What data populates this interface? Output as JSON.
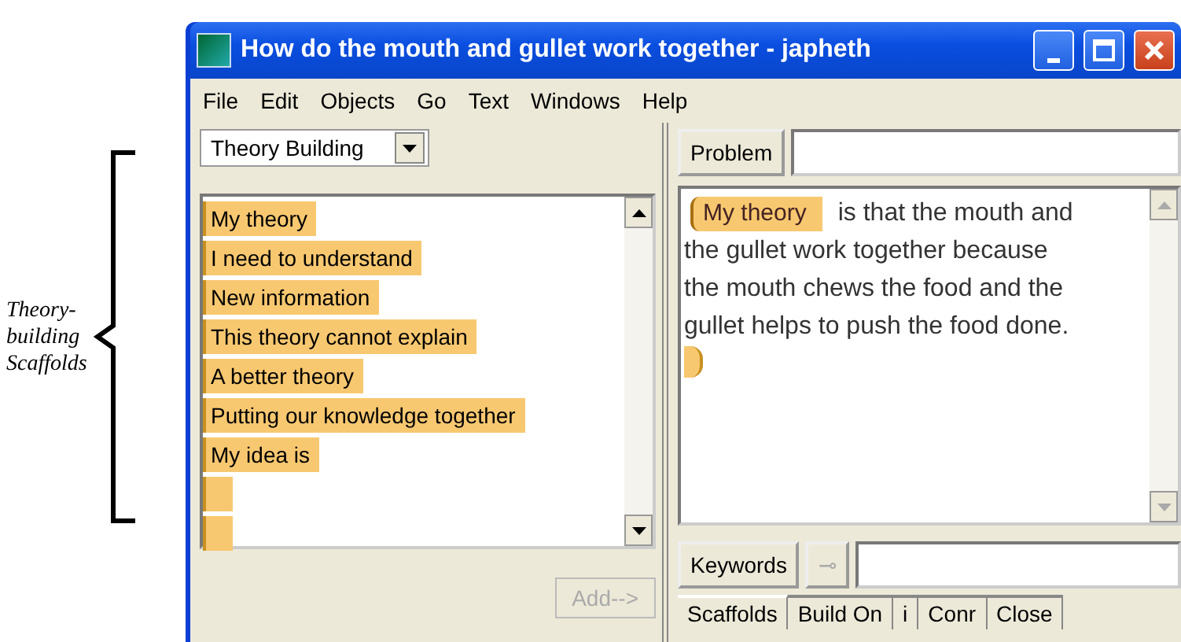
{
  "annotation": {
    "label": "Theory-building Scaffolds"
  },
  "window": {
    "title": "How do the mouth and gullet work together - japheth"
  },
  "menu": [
    "File",
    "Edit",
    "Objects",
    "Go",
    "Text",
    "Windows",
    "Help"
  ],
  "scaffold_set": {
    "value": "Theory Building"
  },
  "scaffolds": [
    {
      "kind": "tag",
      "label": "My theory"
    },
    {
      "kind": "tag",
      "label": "I need to understand"
    },
    {
      "kind": "tag",
      "label": "New information"
    },
    {
      "kind": "tag",
      "label": "This theory cannot explain"
    },
    {
      "kind": "tag",
      "label": "A better theory"
    },
    {
      "kind": "tag",
      "label": "Putting our knowledge together"
    },
    {
      "kind": "tag",
      "label": "My idea is"
    },
    {
      "kind": "blank"
    },
    {
      "kind": "blank"
    }
  ],
  "add_button": {
    "label": "Add-->",
    "disabled": true
  },
  "problem": {
    "label": "Problem"
  },
  "note": {
    "scaffold": "My theory",
    "lines": [
      "is that the mouth and",
      "the gullet work together because",
      "the mouth chews the food and the",
      "gullet helps to push the food done."
    ]
  },
  "keywords": {
    "label": "Keywords",
    "key_button": "⊸"
  },
  "tabs": [
    {
      "label": "Scaffolds",
      "selected": true
    },
    {
      "label": "Build On",
      "selected": false
    },
    {
      "label": "i",
      "selected": false
    },
    {
      "label": "Conr",
      "selected": false
    },
    {
      "label": "Close",
      "selected": false
    }
  ]
}
